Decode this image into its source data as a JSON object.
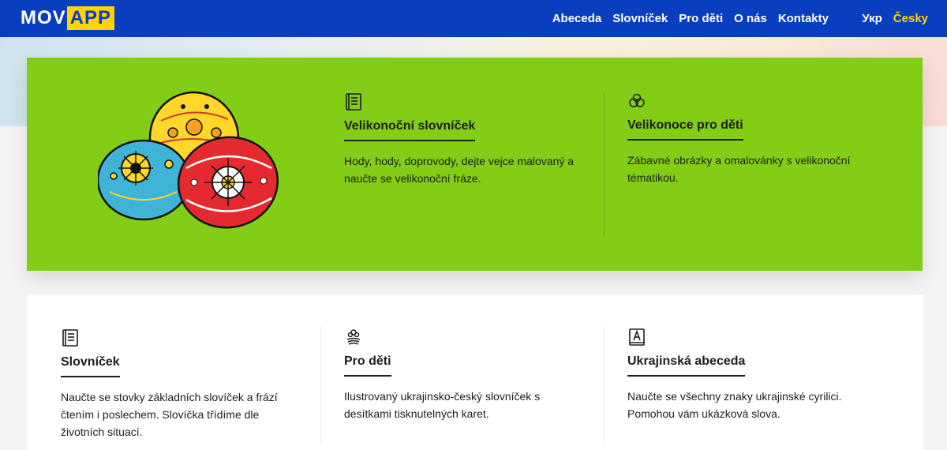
{
  "header": {
    "logo": {
      "part1": "MOV",
      "part2": "APP"
    },
    "nav": [
      "Abeceda",
      "Slovníček",
      "Pro děti",
      "O nás",
      "Kontakty"
    ],
    "languages": {
      "uk": "Укр",
      "cs": "Česky"
    }
  },
  "colors": {
    "header": "#0a3ec1",
    "accent": "#ffd400",
    "easter_card": "#82cd16"
  },
  "easter": {
    "dictionary": {
      "icon": "book-icon",
      "title": "Velikonoční slovníček",
      "text": "Hody, hody, doprovody, dejte vejce malovaný a naučte se velikonoční fráze."
    },
    "kids": {
      "icon": "clouds-icon",
      "title": "Velikonoce pro děti",
      "text": "Zábavné obrázky a omalovánky s velikonoční tématikou."
    }
  },
  "sections": [
    {
      "icon": "book-icon",
      "title": "Slovníček",
      "text": "Naučte se stovky základních slovíček a frází čtením i poslechem. Slovíčka třídíme dle životních situací."
    },
    {
      "icon": "flower-icon",
      "title": "Pro děti",
      "text": "Ilustrovaný ukrajinsko-český slovníček s desítkami tisknutelných karet."
    },
    {
      "icon": "letter-a-icon",
      "title": "Ukrajinská abeceda",
      "text": "Naučte se všechny znaky ukrajinské cyrilici. Pomohou vám ukázková slova."
    }
  ]
}
